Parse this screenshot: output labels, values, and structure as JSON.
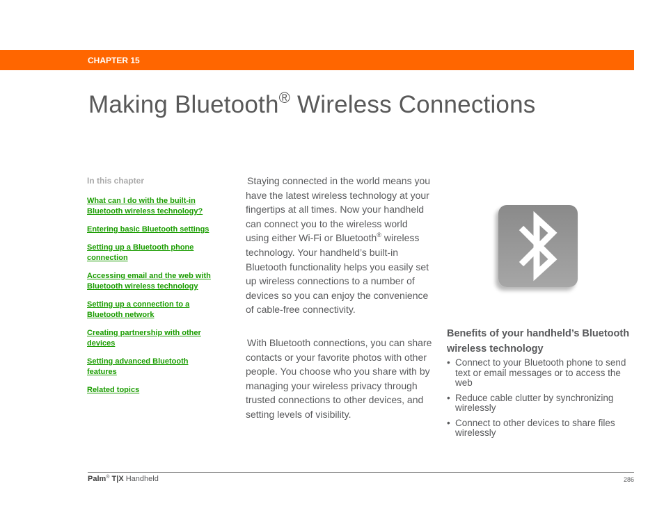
{
  "header": {
    "chapter_label": "CHAPTER 15",
    "accent_color": "#ff6600"
  },
  "title": {
    "text_before": "Making Bluetooth",
    "registered_mark": "®",
    "text_after": " Wireless Connections"
  },
  "toc": {
    "heading": "In this chapter",
    "link_color": "#1a9c00",
    "items": [
      {
        "label": "What can I do with the built-in Bluetooth wireless technology?"
      },
      {
        "label": "Entering basic Bluetooth settings"
      },
      {
        "label": "Setting up a Bluetooth phone connection"
      },
      {
        "label": "Accessing email and the web with Bluetooth wireless technology"
      },
      {
        "label": "Setting up a connection to a Bluetooth network"
      },
      {
        "label": "Creating partnership with other devices"
      },
      {
        "label": "Setting advanced Bluetooth features"
      },
      {
        "label": "Related topics"
      }
    ]
  },
  "intro": {
    "para1_a": "Staying connected in the world means you have the latest wireless technology at your fingertips at all times. Now your handheld can connect you to the wireless world using either Wi-Fi or Bluetooth",
    "para1_mark": "®",
    "para1_b": " wireless technology. Your handheld’s built-in Bluetooth functionality helps you easily set up wireless connections to a number of devices so you can enjoy the convenience of cable-free connectivity.",
    "para2": "With Bluetooth connections, you can share contacts or your favorite photos with other people. You choose who you share with by managing your wireless privacy through trusted connections to other devices, and setting levels of visibility."
  },
  "icon": {
    "name": "bluetooth-icon"
  },
  "benefits": {
    "heading": "Benefits of your handheld’s Bluetooth wireless technology",
    "bullet": "•",
    "items": [
      {
        "text": "Connect to your Bluetooth phone to send text or email messages or to access the web"
      },
      {
        "text": "Reduce cable clutter by synchronizing wirelessly"
      },
      {
        "text": "Connect to other devices to share files wirelessly"
      }
    ]
  },
  "footer": {
    "brand": "Palm",
    "brand_mark": "®",
    "model": "T|X",
    "product": " Handheld",
    "page_number": "286"
  }
}
